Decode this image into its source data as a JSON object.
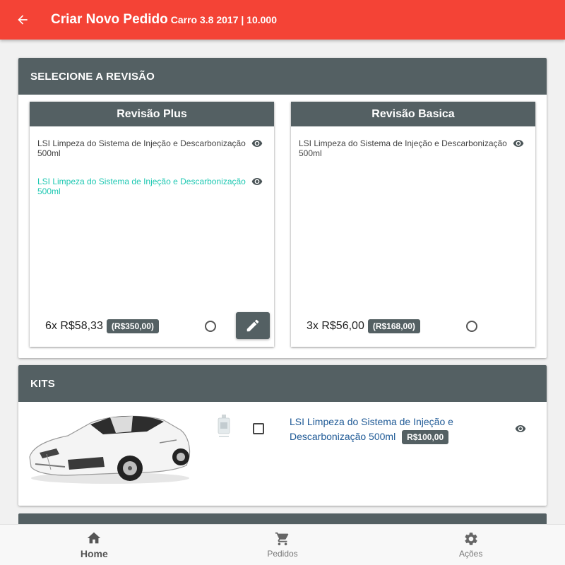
{
  "appbar": {
    "title": "Criar Novo Pedido",
    "subtitle": "Carro 3.8 2017 | 10.000",
    "color": "#f44336"
  },
  "revisao_section": {
    "header": "SELECIONE A REVISÃO",
    "cards": [
      {
        "title": "Revisão Plus",
        "items": [
          {
            "text": "LSI Limpeza do Sistema de Injeção e Descarbonização 500ml",
            "highlighted": false
          },
          {
            "text": "LSI Limpeza do Sistema de Injeção e Descarbonização 500ml",
            "highlighted": true
          }
        ],
        "installments": "6x R$58,33",
        "total": "(R$350,00)",
        "selected": false,
        "has_edit": true
      },
      {
        "title": "Revisão Basica",
        "items": [
          {
            "text": "LSI Limpeza do Sistema de Injeção e Descarbonização 500ml",
            "highlighted": false
          }
        ],
        "installments": "3x R$56,00",
        "total": "(R$168,00)",
        "selected": false,
        "has_edit": false
      }
    ]
  },
  "kits_section": {
    "header": "KITS",
    "items": [
      {
        "name": "LSI Limpeza do Sistema de Injeção e Descarbonização 500ml",
        "price": "R$100,00",
        "checked": false
      }
    ]
  },
  "bottom_nav": [
    {
      "label": "Home",
      "icon": "home-icon",
      "active": true
    },
    {
      "label": "Pedidos",
      "icon": "cart-icon",
      "active": false
    },
    {
      "label": "Ações",
      "icon": "gear-icon",
      "active": false
    }
  ],
  "colors": {
    "header_gray": "#546063",
    "highlight_teal": "#1ec8b2",
    "link_blue": "#1f5a96"
  }
}
